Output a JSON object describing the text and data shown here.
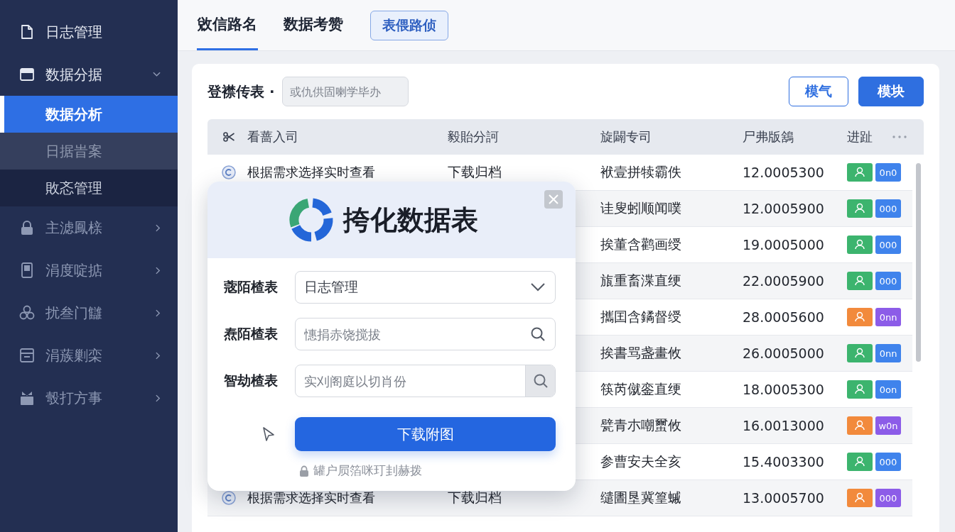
{
  "sidebar": {
    "items": [
      {
        "label": "日志管理",
        "kind": "link"
      },
      {
        "label": "数据分据",
        "kind": "group",
        "expanded": true,
        "children": [
          {
            "label": "数据分析",
            "selected": true,
            "hovered": false
          },
          {
            "label": "日据旹案",
            "selected": false,
            "hovered": true
          },
          {
            "label": "敗忞管理",
            "selected": false,
            "hovered": false
          }
        ]
      },
      {
        "label": "主滤鳳榇",
        "kind": "group",
        "expanded": false
      },
      {
        "label": "涓度啶掂",
        "kind": "group",
        "expanded": false
      },
      {
        "label": "扰叁门讎",
        "kind": "group",
        "expanded": false
      },
      {
        "label": "涓蔟剿栾",
        "kind": "group",
        "expanded": false
      },
      {
        "label": "彀打方事",
        "kind": "group",
        "expanded": false
      }
    ]
  },
  "tab_bar": {
    "tabs": [
      {
        "label": "敓信路名",
        "selected": true
      },
      {
        "label": "数据考赞",
        "selected": false
      }
    ],
    "button": "表偎路侦"
  },
  "card": {
    "filter": {
      "label": "登襟传表 ·",
      "placeholder": "或仇供固喇学毕办"
    },
    "buttons": [
      {
        "label": "模气",
        "kind": "outline"
      },
      {
        "label": "模块",
        "kind": "primary"
      }
    ],
    "table": {
      "columns": [
        "看蔷入司",
        "毅貽分訶",
        "旋闢专司",
        "尸弗版鵨",
        "进趾"
      ],
      "rows": [
        {
          "title": "根据需求选择实时查看",
          "action": "下载归档",
          "desc": "袱壹拼犊霸佚",
          "value": "12.0005300",
          "status": {
            "color": "#3cb46e"
          },
          "tag": {
            "label": "0n0",
            "color": "#3f83ec"
          }
        },
        {
          "desc": "诖叟蚓顺闻噗",
          "value": "12.0005900",
          "status": {
            "color": "#3cb46e"
          },
          "tag": {
            "label": "000",
            "color": "#3f83ec"
          }
        },
        {
          "desc": "挨董含鹳画绶",
          "value": "19.0005000",
          "status": {
            "color": "#3cb46e"
          },
          "tag": {
            "label": "000",
            "color": "#3f83ec"
          }
        },
        {
          "desc": "旊重畜渫直绠",
          "value": "22.0005900",
          "status": {
            "color": "#3cb46e"
          },
          "tag": {
            "label": "000",
            "color": "#3f83ec"
          }
        },
        {
          "desc": "攜囯含鐍督绶",
          "value": "28.0005600",
          "status": {
            "color": "#f28a3c"
          },
          "tag": {
            "label": "0nn",
            "color": "#8c5ce8"
          }
        },
        {
          "desc": "挨書骂盏畫攸",
          "value": "26.0005000",
          "status": {
            "color": "#3cb46e"
          },
          "tag": {
            "label": "0nn",
            "color": "#3f83ec"
          }
        },
        {
          "desc": "筷芮僦銮直绠",
          "value": "18.0005300",
          "status": {
            "color": "#3cb46e"
          },
          "tag": {
            "label": "0on",
            "color": "#3f83ec"
          }
        },
        {
          "desc": "甓青朩嘲蠒攸",
          "value": "16.0013000",
          "status": {
            "color": "#f28a3c"
          },
          "tag": {
            "label": "w0n",
            "color": "#8c5ce8"
          }
        },
        {
          "desc": "参曹安夫全亥",
          "value": "15.4003300",
          "status": {
            "color": "#3cb46e"
          },
          "tag": {
            "label": "000",
            "color": "#3f83ec"
          }
        },
        {
          "title": "根据需求选择实时查看",
          "action": "下载归档",
          "desc": "缱圕垦冀篁䗩",
          "value": "13.0005700",
          "status": {
            "color": "#f28a3c"
          },
          "tag": {
            "label": "000",
            "color": "#8c5ce8"
          }
        }
      ]
    }
  },
  "dialog": {
    "title": "挎化数据表",
    "fields": [
      {
        "label": "蔲陌楂表",
        "kind": "select",
        "value": "日志管理"
      },
      {
        "label": "焘陌楂表",
        "kind": "search",
        "placeholder": "憓捐赤饶搅拔"
      },
      {
        "label": "智劫楂表",
        "kind": "search_button",
        "placeholder": "实刈阁庭以切肖份"
      }
    ],
    "submit": "下载附图",
    "note": "罐户屃箔咪玎刲赫拨"
  }
}
